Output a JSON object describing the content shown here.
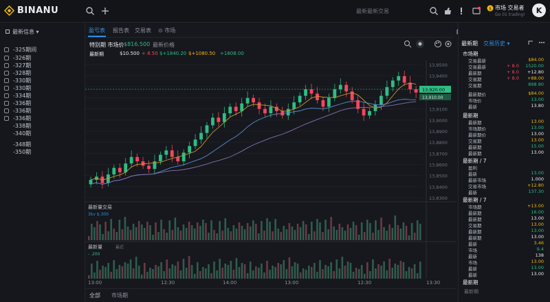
{
  "brand": {
    "name": "BINANU"
  },
  "topbar": {
    "search_placeholder": "最新最新交易",
    "user_name": "市场 交易者",
    "user_sub": "Go 01 trading!",
    "avatar_letter": "K"
  },
  "sidebar": {
    "title": "最新信息",
    "items": [
      {
        "label": "-325期间"
      },
      {
        "label": "-326期"
      },
      {
        "label": "-327期"
      },
      {
        "label": "-328期"
      },
      {
        "label": "-330期"
      },
      {
        "label": "-330期"
      },
      {
        "label": "-334期"
      },
      {
        "label": "-336期"
      },
      {
        "label": "-336期"
      },
      {
        "label": "-336期"
      },
      {
        "label": "-338期"
      },
      {
        "label": "-340期"
      },
      {
        "label": "-348期"
      },
      {
        "label": "-350期"
      }
    ]
  },
  "tabs": [
    {
      "label": "盈亏表"
    },
    {
      "label": "报告表"
    },
    {
      "label": "交易表"
    },
    {
      "label": "市场"
    }
  ],
  "toolbar": {
    "pair": "特别期 市场价",
    "price": "$816.500",
    "sub": "最新价格"
  },
  "pair_row": {
    "label": "最新期",
    "v1": "$10.500",
    "v2": "+ 8.50",
    "v3": "$+1840.20",
    "v4": "$+1080.50",
    "v5": "+1808.00"
  },
  "price_axis": [
    "13,9500",
    "13,9400",
    "13,9300",
    "13,9200",
    "13,9100",
    "13,9000",
    "13,8900",
    "13,8800",
    "13,8700",
    "13,8600",
    "13,8500",
    "13,8400",
    "13,8300"
  ],
  "current_price": "13,920.00",
  "sub_price": "13,910.00",
  "time_axis": [
    "13:00",
    "12:30",
    "14:00",
    "13:00",
    "12:30",
    "13:30"
  ],
  "vol_panel": {
    "title": "最新量交易",
    "v": "3kv  $.300"
  },
  "osc_panel": {
    "title": "最新量",
    "sub": "最近",
    "v": "-  .200"
  },
  "chart_data": {
    "type": "candlestick",
    "note": "BTC style price chart",
    "closes": [
      13.835,
      13.838,
      13.832,
      13.84,
      13.846,
      13.842,
      13.85,
      13.856,
      13.852,
      13.848,
      13.845,
      13.852,
      13.858,
      13.862,
      13.856,
      13.852,
      13.86,
      13.866,
      13.872,
      13.878,
      13.885,
      13.892,
      13.888,
      13.896,
      13.902,
      13.898,
      13.905,
      13.91,
      13.906,
      13.9,
      13.896,
      13.902,
      13.898,
      13.894,
      13.9,
      13.906,
      13.912,
      13.918,
      13.914,
      13.908,
      13.902,
      13.91,
      13.918,
      13.922,
      13.916,
      13.908,
      13.9,
      13.894,
      13.898,
      13.904,
      13.912,
      13.92,
      13.926,
      13.93,
      13.924,
      13.918,
      13.915
    ]
  },
  "right_panel": {
    "title": "最新期",
    "sub": "交易历史",
    "sec1": "市场期",
    "rows1": [
      [
        "交易最新",
        "",
        "$84.00"
      ],
      [
        "交易最新",
        "+ 8.0",
        "1520.00"
      ],
      [
        "最新期",
        "+ 8.0",
        "+12.80"
      ],
      [
        "交易期",
        "+ 8.0",
        "+88.00"
      ],
      [
        "交易期",
        "",
        "898 80"
      ]
    ],
    "rows2": [
      [
        "最新期价",
        "",
        "$84.00"
      ],
      [
        "市场价",
        "",
        "13.00"
      ],
      [
        "最新",
        "",
        "13.80"
      ]
    ],
    "sec2": "最新期",
    "rows3": [
      [
        "最新期",
        "",
        "13.00"
      ],
      [
        "市场期价",
        "",
        "13.00"
      ],
      [
        "最新期价",
        "",
        "13.00"
      ],
      [
        "交易期",
        "",
        "13.00"
      ],
      [
        "最新期",
        "",
        "15.00"
      ],
      [
        "最新期",
        "",
        "13.00"
      ]
    ],
    "sec3": "最新期 / 7",
    "rows4": [
      [
        "盈利",
        "",
        ""
      ],
      [
        "最新",
        "",
        "13.00"
      ],
      [
        "最新市场",
        "",
        "1.000"
      ],
      [
        "交易市场",
        "",
        "+12.80"
      ],
      [
        "最新",
        "",
        "137.30"
      ]
    ],
    "sec4": "最新期 / 7",
    "rows5": [
      [
        "市场期",
        "",
        "+13.00"
      ],
      [
        "最新期",
        "",
        "16.00"
      ],
      [
        "最新期",
        "",
        "13.00"
      ],
      [
        "交易期",
        "",
        "13.00"
      ],
      [
        "最新期",
        "",
        "13.00"
      ],
      [
        "最新期",
        "",
        "13.00"
      ],
      [
        "最新",
        "",
        "3.46"
      ],
      [
        "市场",
        "",
        "9.4"
      ],
      [
        "最新",
        "",
        "138"
      ],
      [
        "市场",
        "",
        "13.00"
      ],
      [
        "最新",
        "",
        "13.00"
      ],
      [
        "最新",
        "",
        "13.00"
      ]
    ],
    "sec5": "最新期",
    "footer": "最新期"
  },
  "bottom_tabs": [
    {
      "label": "全部"
    },
    {
      "label": "市场期"
    }
  ]
}
